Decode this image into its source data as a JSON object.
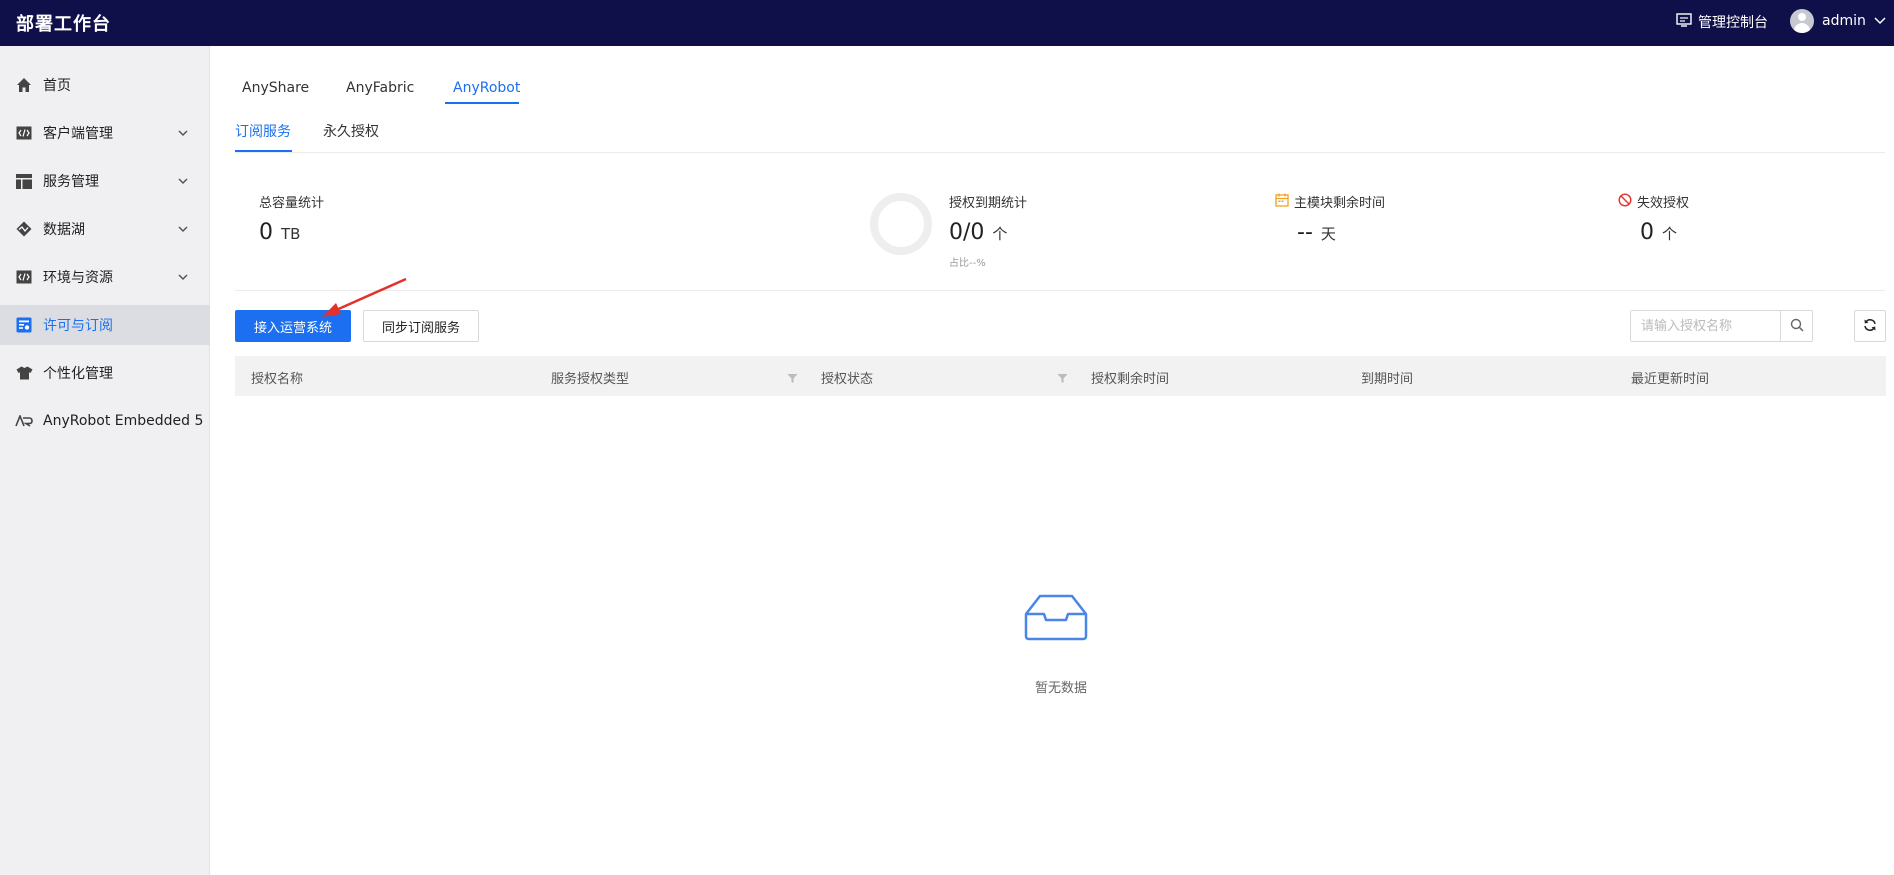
{
  "header": {
    "app_title": "部署工作台",
    "console_label": "管理控制台",
    "user_name": "admin"
  },
  "sidebar": {
    "items": [
      {
        "label": "首页",
        "icon": "home-icon",
        "expandable": false
      },
      {
        "label": "客户端管理",
        "icon": "code-window-icon",
        "expandable": true
      },
      {
        "label": "服务管理",
        "icon": "layout-icon",
        "expandable": true
      },
      {
        "label": "数据湖",
        "icon": "pulse-icon",
        "expandable": true
      },
      {
        "label": "环境与资源",
        "icon": "code-window-icon",
        "expandable": true
      },
      {
        "label": "许可与订阅",
        "icon": "license-icon",
        "expandable": false,
        "active": true
      },
      {
        "label": "个性化管理",
        "icon": "shirt-icon",
        "expandable": false
      },
      {
        "label": "AnyRobot Embedded 5",
        "icon": "anyrobot-icon",
        "expandable": false
      }
    ]
  },
  "product_tabs": [
    {
      "label": "AnyShare"
    },
    {
      "label": "AnyFabric"
    },
    {
      "label": "AnyRobot",
      "active": true
    }
  ],
  "sub_tabs": [
    {
      "label": "订阅服务",
      "active": true
    },
    {
      "label": "永久授权"
    }
  ],
  "stats": {
    "capacity": {
      "label": "总容量统计",
      "value": "0",
      "unit": "TB"
    },
    "expiry": {
      "label": "授权到期统计",
      "value": "0/0",
      "unit": "个",
      "ratio": "占比--%"
    },
    "remaining": {
      "label": "主模块剩余时间",
      "value": "--",
      "unit": "天"
    },
    "invalid": {
      "label": "失效授权",
      "value": "0",
      "unit": "个"
    }
  },
  "actions": {
    "connect_label": "接入运营系统",
    "sync_label": "同步订阅服务"
  },
  "search": {
    "placeholder": "请输入授权名称"
  },
  "table": {
    "columns": [
      "授权名称",
      "服务授权类型",
      "授权状态",
      "授权剩余时间",
      "到期时间",
      "最近更新时间"
    ]
  },
  "empty": {
    "text": "暂无数据"
  },
  "colors": {
    "header_bg": "#0f0f4a",
    "accent": "#1b6ff0",
    "annotation_arrow": "#e5312b"
  }
}
